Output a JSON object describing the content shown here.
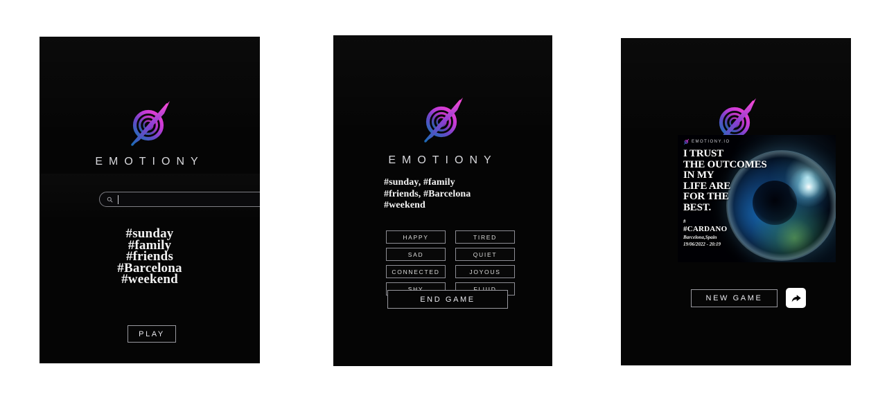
{
  "app": {
    "brand": "EMOTIONY",
    "logo_icon": "emotiony-spiral-logo"
  },
  "panel_start": {
    "search": {
      "value": "",
      "placeholder": "",
      "icon": "search-icon"
    },
    "tags": [
      "#sunday",
      "#family",
      "#friends",
      "#Barcelona",
      "#weekend"
    ],
    "play_label": "PLAY"
  },
  "panel_game": {
    "tag_lines": [
      "#sunday, #family",
      "#friends, #Barcelona",
      "#weekend"
    ],
    "emotions": [
      "HAPPY",
      "TIRED",
      "SAD",
      "QUIET",
      "CONNECTED",
      "JOYOUS",
      "SHY",
      "FLUID"
    ],
    "end_game_label": "END GAME"
  },
  "panel_result": {
    "card": {
      "brand_mark": "EMOTIONY.IO",
      "quote_lines": [
        "I TRUST",
        "THE OUTCOMES",
        "IN MY",
        "LIFE ARE",
        "FOR THE",
        "BEST."
      ],
      "hash_symbol": "#",
      "hashtag": "#CARDANO",
      "place": "Barcelona,Spain",
      "datetime": "19/06/2022 - 20:19"
    },
    "new_game_label": "NEW GAME",
    "share_icon": "share-arrow-icon"
  },
  "colors": {
    "page_background": "#ffffff",
    "panel_background": "#050505",
    "logo_magenta": "#e040c8",
    "logo_purple": "#8d3fd0",
    "logo_blue": "#2a6fb5",
    "text_primary": "#ffffff",
    "text_muted": "#cfcfd4",
    "button_border": "#9a9aa0",
    "globe_blue": "#1b5f93",
    "globe_green": "#7fd65a",
    "glow_cyan": "#cdf6ff"
  }
}
